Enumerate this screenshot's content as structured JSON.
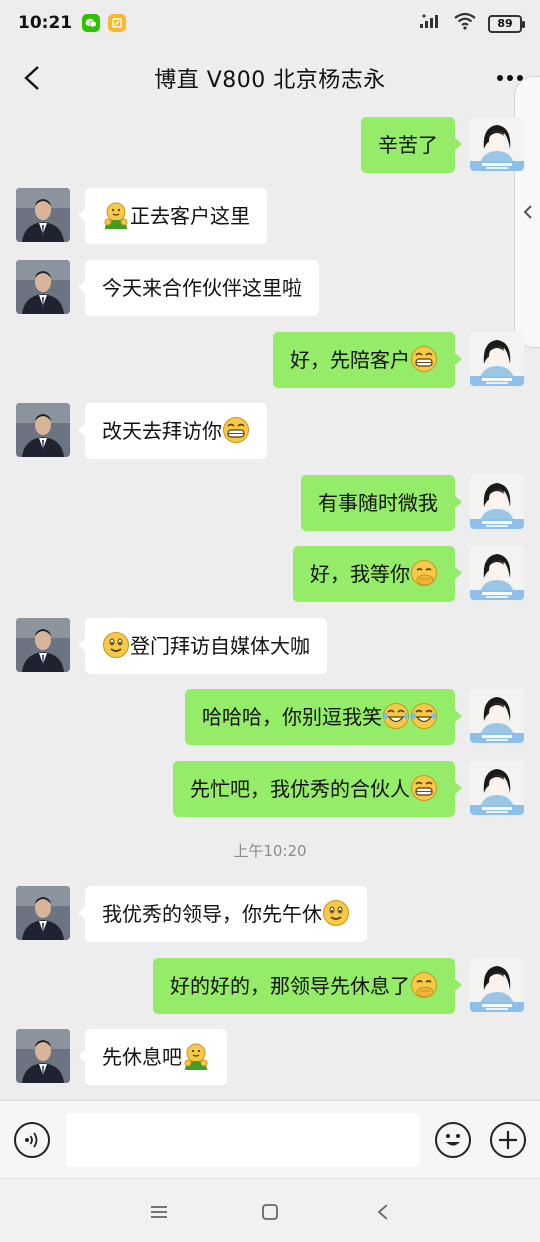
{
  "status": {
    "time": "10:21",
    "battery": "89"
  },
  "header": {
    "title": "博直  V800  北京杨志永"
  },
  "timestamp": "上午10:20",
  "messages": [
    {
      "side": "right",
      "text": "辛苦了",
      "emoji": ""
    },
    {
      "side": "left",
      "text": "正去客户这里",
      "emoji": "hug",
      "emoji_pos": "before"
    },
    {
      "side": "left",
      "text": "今天来合作伙伴这里啦",
      "emoji": ""
    },
    {
      "side": "right",
      "text": "好，先陪客户",
      "emoji": "grin"
    },
    {
      "side": "left",
      "text": "改天去拜访你",
      "emoji": "grin"
    },
    {
      "side": "right",
      "text": "有事随时微我",
      "emoji": ""
    },
    {
      "side": "right",
      "text": "好，我等你",
      "emoji": "thinking"
    },
    {
      "side": "left",
      "text": "登门拜访自媒体大咖",
      "emoji": "smile",
      "emoji_pos": "before"
    },
    {
      "side": "right",
      "text": "哈哈哈，你别逗我笑",
      "emoji": "tears2"
    },
    {
      "side": "right",
      "text": "先忙吧，我优秀的合伙人",
      "emoji": "grin"
    },
    {
      "side": "left",
      "text": "我优秀的领导，你先午休",
      "emoji": "smile"
    },
    {
      "side": "right",
      "text": "好的好的，那领导先休息了",
      "emoji": "thinking"
    },
    {
      "side": "left",
      "text": "先休息吧",
      "emoji": "hug"
    }
  ],
  "icons": {
    "back": "back-arrow-icon",
    "more": "more-dots-icon",
    "voice": "voice-icon",
    "emoji": "emoji-icon",
    "plus": "plus-icon"
  },
  "colors": {
    "bubble_self": "#95ec69",
    "bubble_other": "#ffffff",
    "background": "#ededed"
  }
}
